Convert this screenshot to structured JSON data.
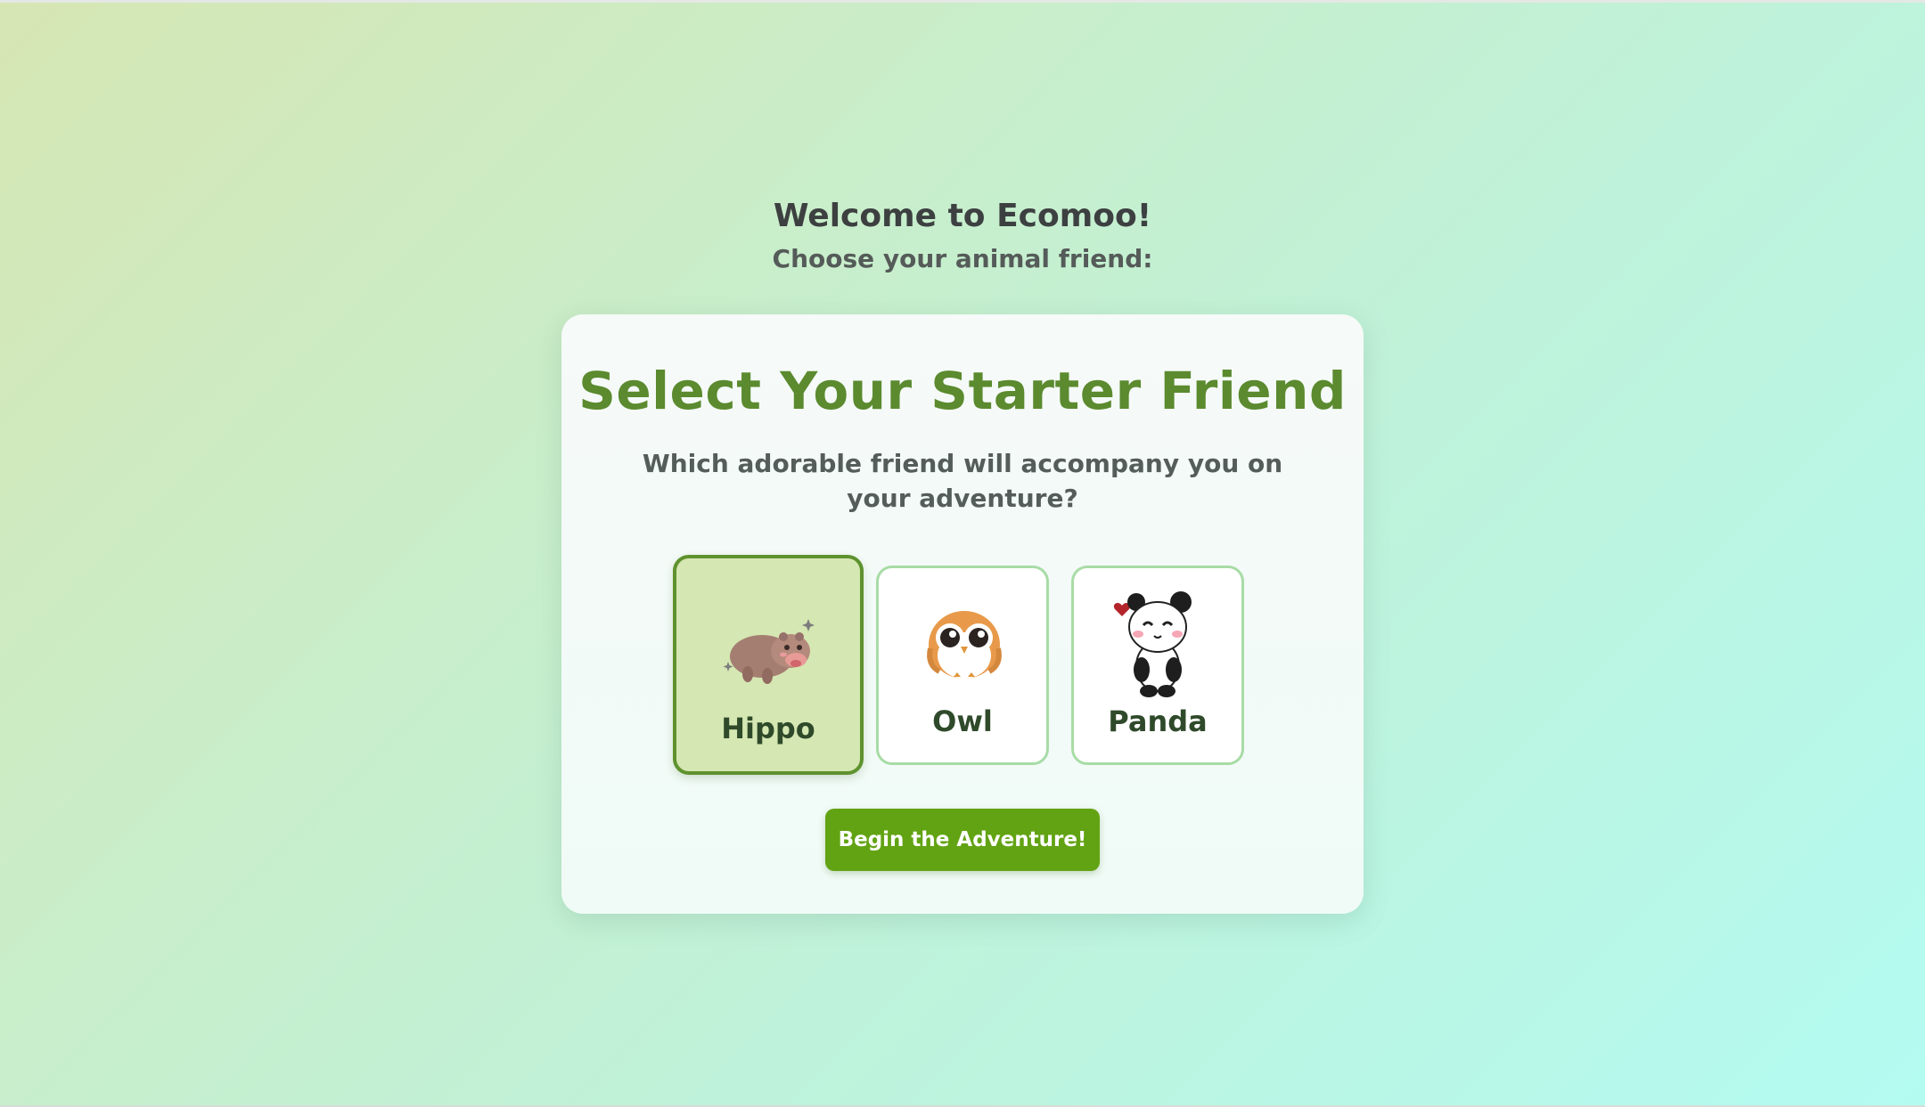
{
  "header": {
    "welcome": "Welcome to Ecomoo!",
    "prompt": "Choose your animal friend:"
  },
  "card": {
    "title": "Select Your Starter Friend",
    "subtitle": "Which adorable friend will accompany you on your adventure?",
    "options": [
      {
        "label": "Hippo",
        "icon": "hippo-icon",
        "selected": true
      },
      {
        "label": "Owl",
        "icon": "owl-icon",
        "selected": false
      },
      {
        "label": "Panda",
        "icon": "panda-icon",
        "selected": false
      }
    ],
    "begin_label": "Begin the Adventure!"
  },
  "colors": {
    "accent_green": "#62a313",
    "title_green": "#5b8a2f",
    "selected_bg": "#d5e7b2",
    "option_border": "#a8dca6"
  }
}
